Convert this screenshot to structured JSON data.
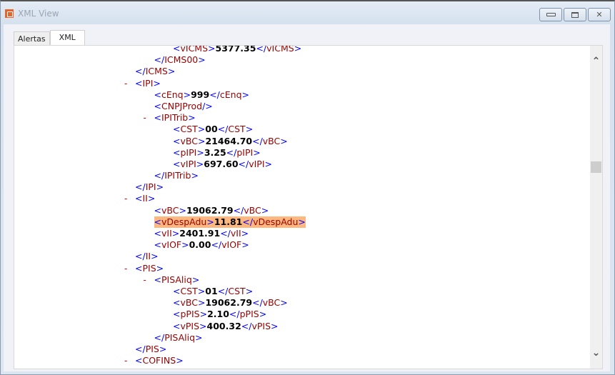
{
  "window": {
    "title": "XML View",
    "minimize_icon": "minimize-icon",
    "maximize_icon": "maximize-icon",
    "close_icon": "close-icon"
  },
  "tabs": [
    {
      "label": "Alertas"
    },
    {
      "label": "XML",
      "active": true
    }
  ],
  "scroll": {
    "position_fraction": 0.36
  },
  "highlight_color": "#fdb77f",
  "lines": [
    {
      "indent": 2,
      "tag": "vICMS",
      "value": "5377.35"
    },
    {
      "indent": 1,
      "close": "ICMS00"
    },
    {
      "indent": 0,
      "close": "ICMS"
    },
    {
      "indent": 0,
      "open": "IPI",
      "toggle": "-"
    },
    {
      "indent": 1,
      "tag": "cEnq",
      "value": "999"
    },
    {
      "indent": 1,
      "empty": "CNPJProd"
    },
    {
      "indent": 1,
      "open": "IPITrib",
      "toggle": "-"
    },
    {
      "indent": 2,
      "tag": "CST",
      "value": "00"
    },
    {
      "indent": 2,
      "tag": "vBC",
      "value": "21464.70"
    },
    {
      "indent": 2,
      "tag": "pIPI",
      "value": "3.25"
    },
    {
      "indent": 2,
      "tag": "vIPI",
      "value": "697.60"
    },
    {
      "indent": 1,
      "close": "IPITrib"
    },
    {
      "indent": 0,
      "close": "IPI"
    },
    {
      "indent": 0,
      "open": "II",
      "toggle": "-"
    },
    {
      "indent": 1,
      "tag": "vBC",
      "value": "19062.79"
    },
    {
      "indent": 1,
      "tag": "vDespAdu",
      "value": "11.81",
      "highlight": true
    },
    {
      "indent": 1,
      "tag": "vII",
      "value": "2401.91"
    },
    {
      "indent": 1,
      "tag": "vIOF",
      "value": "0.00"
    },
    {
      "indent": 0,
      "close": "II"
    },
    {
      "indent": 0,
      "open": "PIS",
      "toggle": "-"
    },
    {
      "indent": 1,
      "open": "PISAliq",
      "toggle": "-"
    },
    {
      "indent": 2,
      "tag": "CST",
      "value": "01"
    },
    {
      "indent": 2,
      "tag": "vBC",
      "value": "19062.79"
    },
    {
      "indent": 2,
      "tag": "pPIS",
      "value": "2.10"
    },
    {
      "indent": 2,
      "tag": "vPIS",
      "value": "400.32"
    },
    {
      "indent": 1,
      "close": "PISAliq"
    },
    {
      "indent": 0,
      "close": "PIS"
    },
    {
      "indent": 0,
      "open": "COFINS",
      "toggle": "-"
    }
  ]
}
